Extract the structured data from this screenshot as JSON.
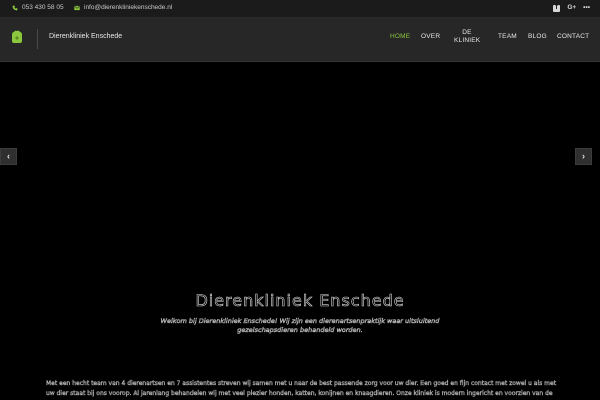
{
  "topbar": {
    "phone": "053 430 58 05",
    "email": "info@dierenkliniekenschede.nl",
    "social_icons": [
      "facebook-icon",
      "google-plus-icon",
      "more-icon"
    ],
    "google_plus_label": "G+",
    "more_label": "•••"
  },
  "navbar": {
    "brand": "Dierenkliniek Enschede",
    "logo_icon": "paw-logo-icon",
    "menu": [
      {
        "label": "HOME",
        "active": true
      },
      {
        "label": "OVER",
        "active": false
      },
      {
        "label_line1": "DE",
        "label_line2": "KLINIEK",
        "active": false
      },
      {
        "label": "TEAM",
        "active": false
      },
      {
        "label": "BLOG",
        "active": false
      },
      {
        "label": "CONTACT",
        "active": false
      }
    ]
  },
  "hero": {
    "title": "Dierenkliniek Enschede",
    "subtitle": "Welkom bij Dierenkliniek Enschede! Wij zijn een dierenartsenpraktijk waar uitsluitend gezelschapsdieren behandeld worden.",
    "body_line1": "Met een hecht team van 4 dierenartsen en 7 assistentes streven wij samen met u naar de best passende zorg voor uw dier. Een goed en fijn contact met zowel u als met",
    "body_line2": "uw dier staat bij ons voorop. Al jarenlang behandelen wij met veel plezier honden, katten, konijnen en knaagdieren. Onze kliniek is modern ingericht en voorzien van de",
    "prev_icon": "chevron-left-icon",
    "next_icon": "chevron-right-icon"
  },
  "colors": {
    "accent": "#8cc63f",
    "topbar_bg": "#1b1b1b",
    "navbar_bg": "#272727",
    "hero_bg": "#000000"
  }
}
